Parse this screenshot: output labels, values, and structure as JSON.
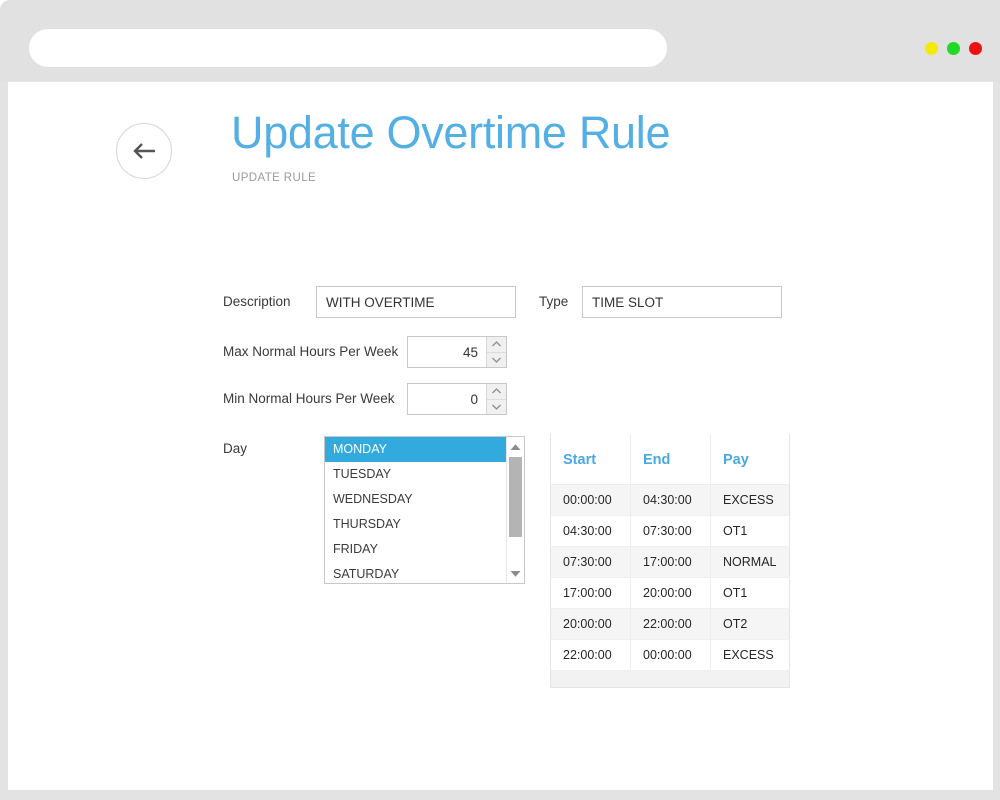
{
  "browser": {
    "address_value": "",
    "address_placeholder": "",
    "controls": [
      {
        "name": "minimize-dot",
        "color": "#f5e90a"
      },
      {
        "name": "maximize-dot",
        "color": "#21d825"
      },
      {
        "name": "close-dot",
        "color": "#ee1111"
      }
    ]
  },
  "header": {
    "title": "Update Overtime Rule",
    "subtitle": "UPDATE RULE",
    "back_icon": "arrow-left-icon",
    "title_color": "#54b0e4"
  },
  "form": {
    "description": {
      "label": "Description",
      "value": "WITH OVERTIME",
      "placeholder": ""
    },
    "type": {
      "label": "Type",
      "value": "TIME SLOT",
      "placeholder": ""
    },
    "max_hours": {
      "label": "Max Normal Hours Per Week",
      "value": "45"
    },
    "min_hours": {
      "label": "Min Normal Hours Per Week",
      "value": "0"
    },
    "day": {
      "label": "Day",
      "selected": "MONDAY",
      "options": [
        "MONDAY",
        "TUESDAY",
        "WEDNESDAY",
        "THURSDAY",
        "FRIDAY",
        "SATURDAY"
      ],
      "selection_color": "#32aadd"
    }
  },
  "slots_table": {
    "columns": [
      "Start",
      "End",
      "Pay"
    ],
    "header_color": "#4aa9e2",
    "rows": [
      {
        "start": "00:00:00",
        "end": "04:30:00",
        "pay": "EXCESS"
      },
      {
        "start": "04:30:00",
        "end": "07:30:00",
        "pay": "OT1"
      },
      {
        "start": "07:30:00",
        "end": "17:00:00",
        "pay": "NORMAL"
      },
      {
        "start": "17:00:00",
        "end": "20:00:00",
        "pay": "OT1"
      },
      {
        "start": "20:00:00",
        "end": "22:00:00",
        "pay": "OT2"
      },
      {
        "start": "22:00:00",
        "end": "00:00:00",
        "pay": "EXCESS"
      }
    ]
  }
}
